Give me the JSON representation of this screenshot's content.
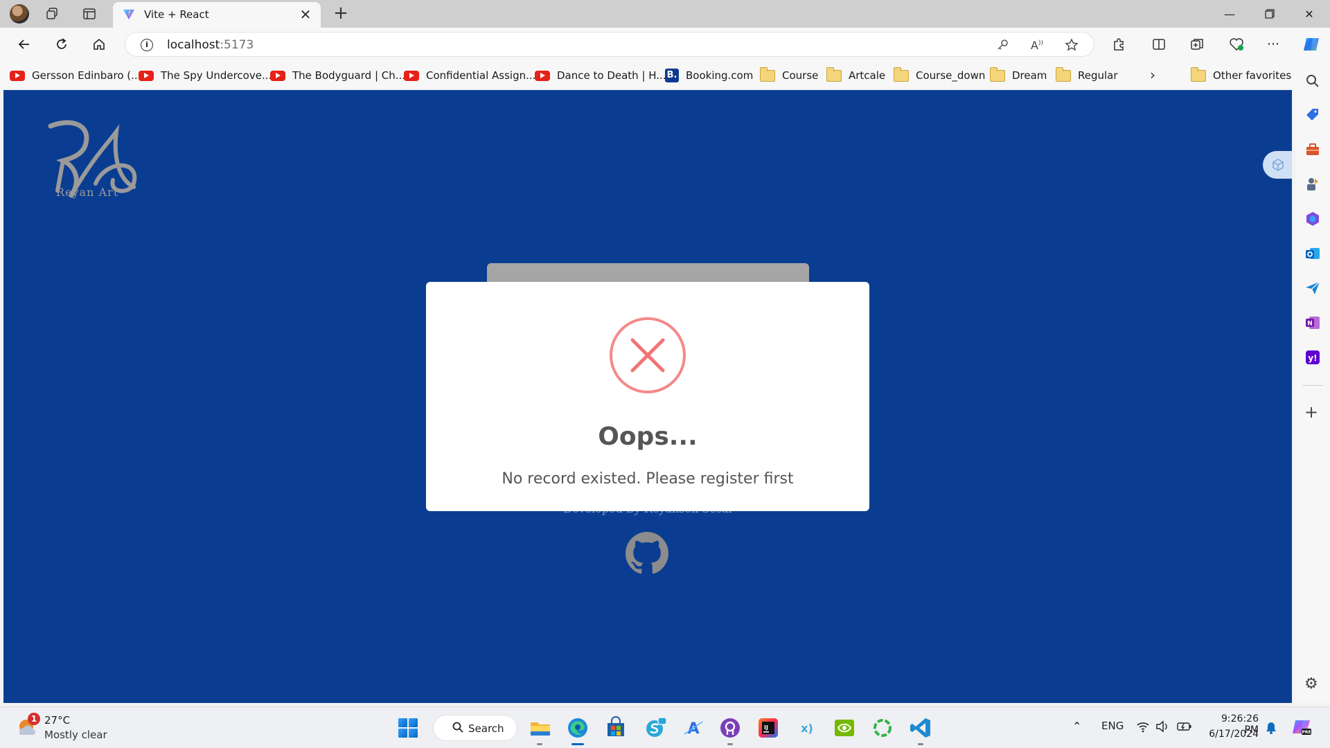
{
  "browser": {
    "tab_title": "Vite + React",
    "url_host": "localhost",
    "url_port": ":5173"
  },
  "favorites": {
    "items": [
      {
        "label": "Gersson Edinbaro (...",
        "icon": "youtube-icon"
      },
      {
        "label": "The Spy Undercove...",
        "icon": "youtube-icon"
      },
      {
        "label": "The Bodyguard | Ch...",
        "icon": "youtube-icon"
      },
      {
        "label": "Confidential Assign...",
        "icon": "youtube-icon"
      },
      {
        "label": "Dance to Death | H...",
        "icon": "youtube-icon"
      },
      {
        "label": "Booking.com",
        "icon": "booking-icon",
        "badge": "B."
      },
      {
        "label": "Course",
        "icon": "folder-icon"
      },
      {
        "label": "Artcale",
        "icon": "folder-icon"
      },
      {
        "label": "Course_down",
        "icon": "folder-icon"
      },
      {
        "label": "Dream",
        "icon": "folder-icon"
      },
      {
        "label": "Regular",
        "icon": "folder-icon"
      }
    ],
    "other": "Other favorites"
  },
  "page": {
    "logo_text": "Reyan Art",
    "footer_text": "Developed By Reyanson Sesai",
    "background_color": "#0a3d91"
  },
  "modal": {
    "title": "Oops...",
    "message": "No record existed. Please register first",
    "icon": "error-x-icon",
    "icon_color": "#f27474"
  },
  "taskbar": {
    "weather_badge": "1",
    "weather_temp": "27°C",
    "weather_desc": "Mostly clear",
    "search_label": "Search",
    "language": "ENG",
    "time": "9:26:26 PM",
    "date": "6/17/2024"
  }
}
